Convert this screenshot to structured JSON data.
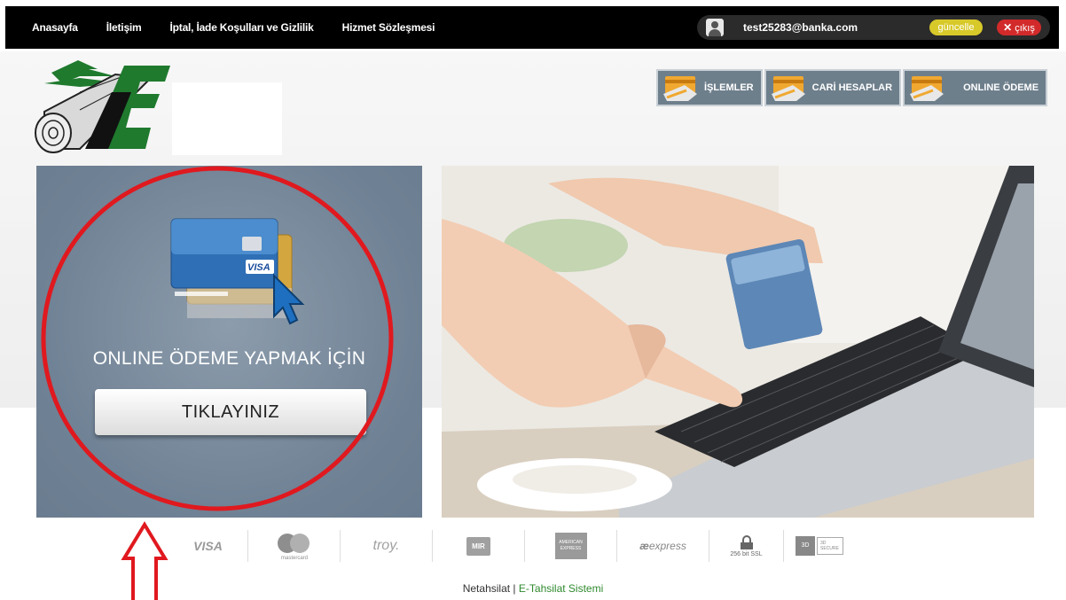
{
  "nav": {
    "items": [
      "Anasayfa",
      "İletişim",
      "İptal, İade Koşulları ve Gizlilik",
      "Hizmet Sözleşmesi"
    ]
  },
  "user": {
    "email": "test25283@banka.com",
    "update_label": "güncelle",
    "exit_label": "çıkış"
  },
  "header_buttons": [
    {
      "label": "İŞLEMLER"
    },
    {
      "label": "CARİ HESAPLAR"
    },
    {
      "label": "ONLINE ÖDEME"
    }
  ],
  "payment_panel": {
    "text": "ONLINE ÖDEME YAPMAK İÇİN",
    "button_label": "TIKLAYINIZ"
  },
  "payment_logos": {
    "visa": "VISA",
    "mastercard": "mastercard",
    "troy": "troy.",
    "mir": "MIR",
    "amex": "AMERICAN EXPRESS",
    "express": "express",
    "ssl": "256 bit SSL",
    "secure": "3D SECURE"
  },
  "footer": {
    "brand": "Netahsilat",
    "separator": " | ",
    "system": "E-Tahsilat Sistemi"
  },
  "colors": {
    "topbar": "#000000",
    "panel": "#6f8194",
    "annotation": "#e0191f",
    "update": "#d8c92a",
    "exit": "#d22a2a"
  }
}
